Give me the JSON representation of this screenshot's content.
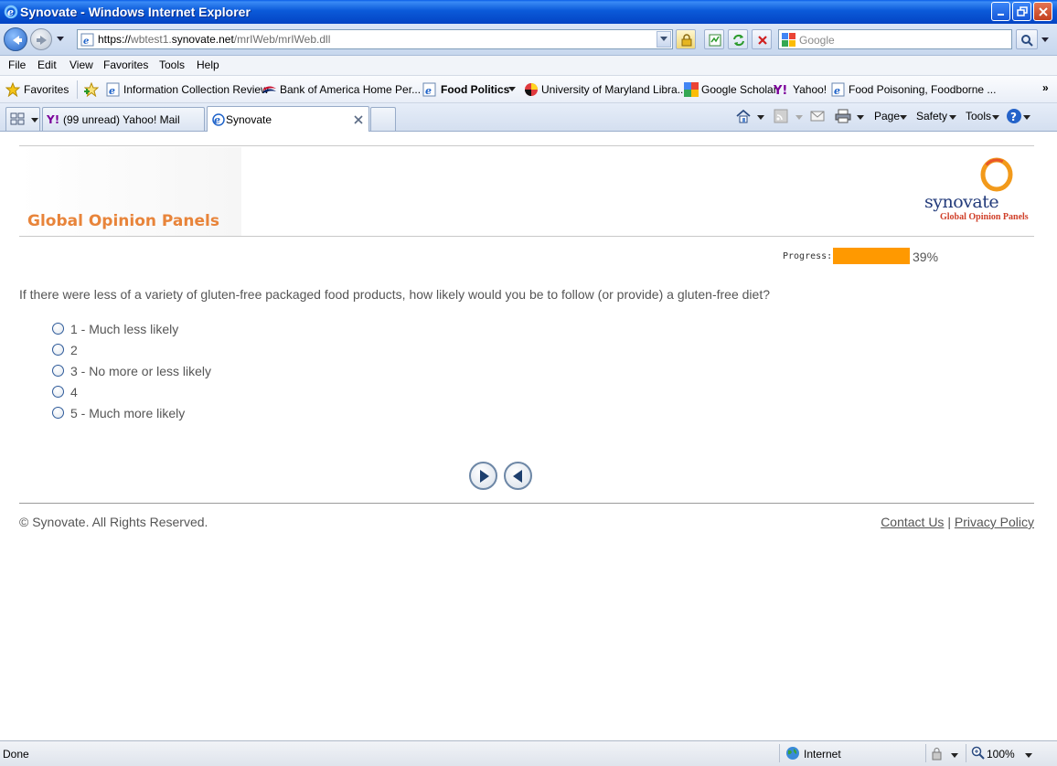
{
  "window": {
    "title": "Synovate - Windows Internet Explorer"
  },
  "address_bar": {
    "url_scheme": "https://",
    "url_sub": "wbtest1.",
    "url_host": "synovate.net",
    "url_path": "/mrIWeb/mrIWeb.dll",
    "search_placeholder": "Google"
  },
  "menu": {
    "items": [
      "File",
      "Edit",
      "View",
      "Favorites",
      "Tools",
      "Help"
    ]
  },
  "favorites_bar": {
    "favorites_label": "Favorites",
    "items": [
      "Information Collection Review",
      "Bank of America  Home  Per...",
      "Food Politics",
      "University of Maryland Libra...",
      "Google Scholar",
      "Yahoo!",
      "Food Poisoning, Foodborne ..."
    ]
  },
  "tabs": [
    {
      "label": "(99 unread) Yahoo! Mail"
    },
    {
      "label": "Synovate"
    }
  ],
  "command_bar": {
    "page": "Page",
    "safety": "Safety",
    "tools": "Tools"
  },
  "survey": {
    "brand_title": "Global Opinion Panels",
    "logo_word": "synovate",
    "logo_sub": "Global Opinion Panels",
    "progress_label": "Progress:",
    "progress_value": 0.39,
    "progress_text": "39%",
    "question": "If there were less of a variety of gluten-free packaged food products, how likely would you be to follow (or provide) a gluten-free diet?",
    "options": [
      "1 - Much less likely",
      "2",
      "3 - No more or less likely",
      "4",
      "5 - Much more likely"
    ],
    "footer_copyright": "© Synovate. All Rights Reserved.",
    "contact_link": "Contact Us",
    "separator": "|",
    "privacy_link": "Privacy Policy"
  },
  "status_bar": {
    "status": "Done",
    "zone": "Internet",
    "zoom": "100%"
  },
  "colors": {
    "brand_orange": "#e8843a",
    "progress_fill": "#ff9900",
    "logo_navy": "#223a7a",
    "logo_red": "#d0402a"
  }
}
